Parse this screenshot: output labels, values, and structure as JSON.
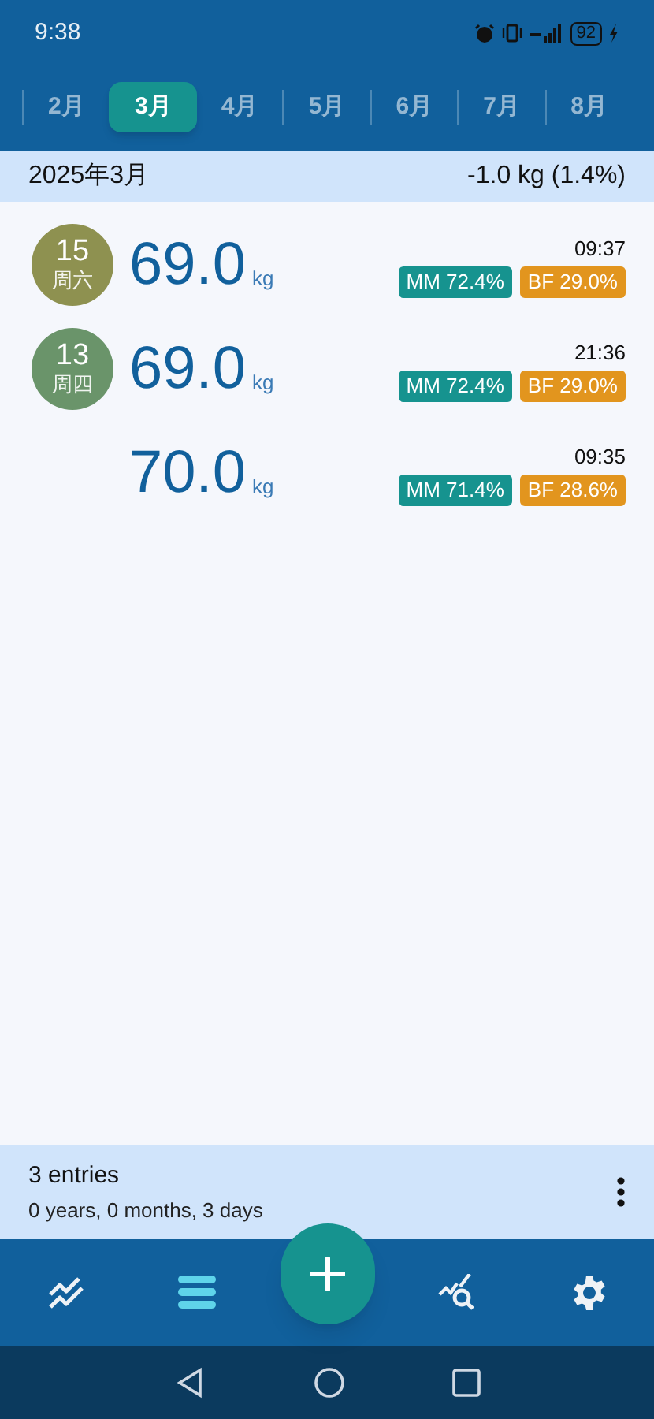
{
  "status_bar": {
    "time": "9:38",
    "battery": "92"
  },
  "month_tabs": [
    {
      "label": "2月",
      "selected": false
    },
    {
      "label": "3月",
      "selected": true
    },
    {
      "label": "4月",
      "selected": false
    },
    {
      "label": "5月",
      "selected": false
    },
    {
      "label": "6月",
      "selected": false
    },
    {
      "label": "7月",
      "selected": false
    },
    {
      "label": "8月",
      "selected": false
    }
  ],
  "month_header": {
    "title": "2025年3月",
    "change": "-1.0 kg (1.4%)"
  },
  "entries": [
    {
      "day": "15",
      "weekday": "周六",
      "color": "#8e9150",
      "weight": "69.0",
      "unit": "kg",
      "time": "09:37",
      "muscle": "MM 72.4%",
      "fat": "BF 29.0%"
    },
    {
      "day": "13",
      "weekday": "周四",
      "color": "#6a946a",
      "weight": "69.0",
      "unit": "kg",
      "time": "21:36",
      "muscle": "MM 72.4%",
      "fat": "BF 29.0%"
    },
    {
      "weight": "70.0",
      "unit": "kg",
      "time": "09:35",
      "muscle": "MM 71.4%",
      "fat": "BF 28.6%"
    }
  ],
  "summary": {
    "count": "3 entries",
    "span": "0 years, 0 months, 3 days"
  },
  "bottom_nav": [
    {
      "kind": "trend",
      "selected": false
    },
    {
      "kind": "list",
      "selected": true
    },
    {
      "kind": "add"
    },
    {
      "kind": "analysis",
      "selected": false
    },
    {
      "kind": "settings",
      "selected": false
    }
  ]
}
